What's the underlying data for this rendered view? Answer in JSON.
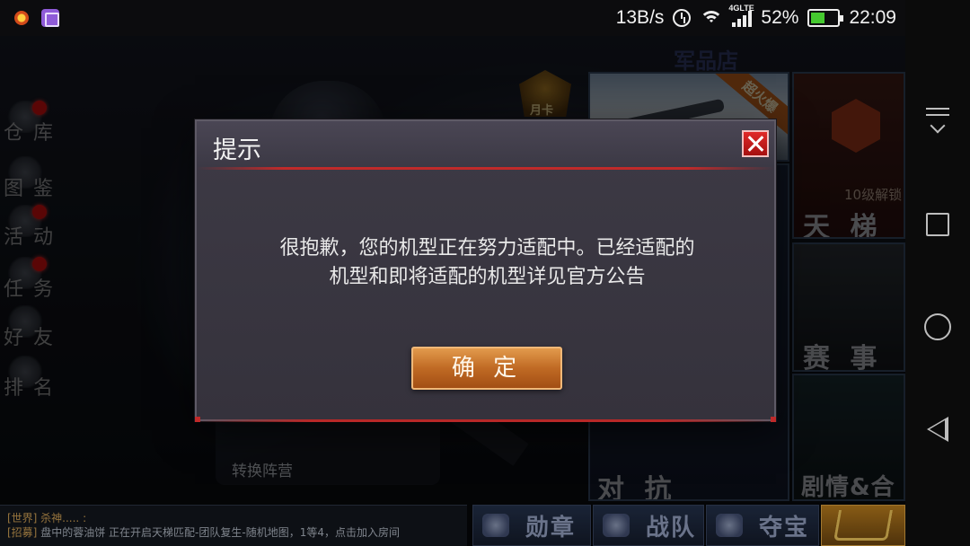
{
  "status_bar": {
    "net_speed": "13B/s",
    "network_label": "4GLTE",
    "battery_percent": "52%",
    "battery_level": 0.52,
    "time": "22:09",
    "icons": [
      "notification-app-icon",
      "gallery-app-icon",
      "alarm-icon",
      "wifi-icon",
      "signal-icon",
      "battery-icon"
    ]
  },
  "background": {
    "sign_text": "军品店 ",
    "left_menu": [
      {
        "label": "仓 库",
        "badge": true
      },
      {
        "label": "图 鉴",
        "badge": false
      },
      {
        "label": "活 动",
        "badge": true
      },
      {
        "label": "任 务",
        "badge": true
      },
      {
        "label": "好 友",
        "badge": false
      },
      {
        "label": "排 名",
        "badge": false
      }
    ],
    "month_card_label": "月卡",
    "ribbon_label": "超火爆",
    "ladder_lock_label": "10级解锁",
    "tiles": {
      "ladder": "天 梯",
      "match": "赛 事",
      "versus": "对 抗",
      "story": "剧情&合"
    },
    "switch_camp": "转换阵营",
    "chat": {
      "line1": "[世界] 杀神..... :",
      "line2_tag": "[招募]",
      "line2_name": "盘中的蓉油饼",
      "line2_text": "正在开启天梯匹配-团队复生-随机地图，1等4，点击加入房间"
    },
    "bottom_buttons": {
      "medal": "勋章",
      "team": "战队",
      "treasure": "夺宝"
    }
  },
  "dialog": {
    "title": "提示",
    "message_line1": "很抱歉，您的机型正在努力适配中。已经适配的",
    "message_line2": "机型和即将适配的机型详见官方公告",
    "confirm_label": "确 定"
  },
  "colors": {
    "dialog_bg": "#3a3742",
    "accent_red": "#c02a2a",
    "confirm_button": "#c06a24",
    "battery_green": "#45c92f"
  }
}
